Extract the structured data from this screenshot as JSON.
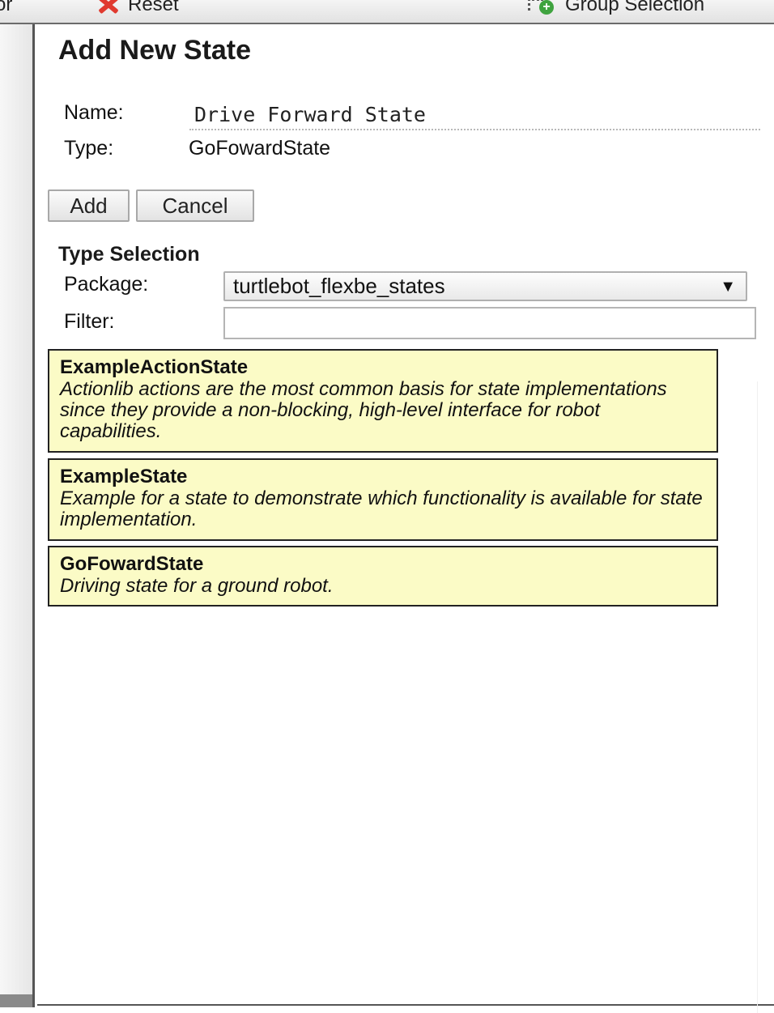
{
  "toolbar": {
    "left_cut_text": "or",
    "reset_label": "Reset",
    "group_selection_label": "Group Selection"
  },
  "dialog": {
    "title": "Add New State",
    "name_label": "Name:",
    "name_value": "Drive Forward State",
    "type_label": "Type:",
    "type_value": "GoFowardState",
    "add_label": "Add",
    "cancel_label": "Cancel"
  },
  "type_selection": {
    "title": "Type Selection",
    "package_label": "Package:",
    "package_value": "turtlebot_flexbe_states",
    "filter_label": "Filter:",
    "filter_value": ""
  },
  "states": [
    {
      "name": "ExampleActionState",
      "description": "Actionlib actions are the most common basis for state implementations since they provide a non-blocking, high-level interface for robot capabilities."
    },
    {
      "name": "ExampleState",
      "description": "Example for a state to demonstrate which functionality is available for state implementation."
    },
    {
      "name": "GoFowardState",
      "description": "Driving state for a ground robot."
    }
  ],
  "colors": {
    "card_background": "#fbfbc6",
    "reset_icon": "#e03a2f",
    "group_icon_accent": "#3fa33f"
  },
  "icons": [
    "reset-x-icon",
    "group-selection-icon",
    "dropdown-arrow-icon"
  ]
}
